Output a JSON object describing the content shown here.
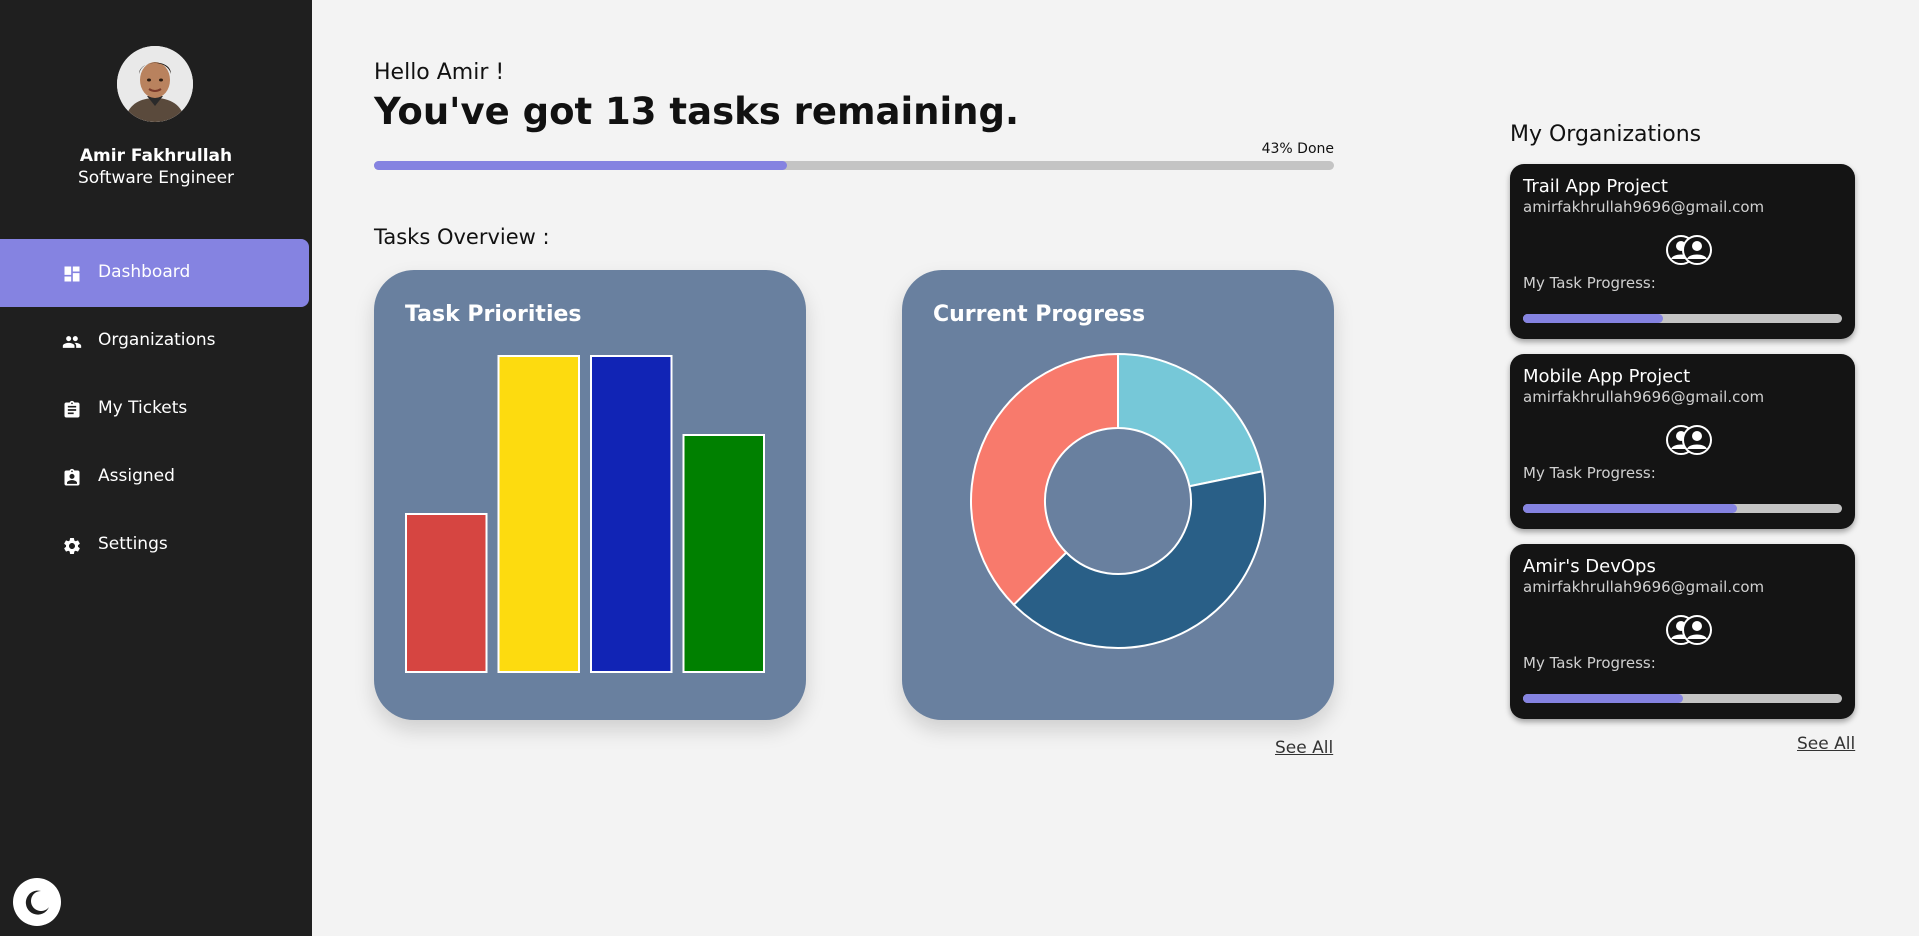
{
  "profile": {
    "name": "Amir Fakhrullah",
    "role": "Software Engineer"
  },
  "nav": [
    {
      "label": "Dashboard",
      "icon": "dashboard-icon",
      "active": true
    },
    {
      "label": "Organizations",
      "icon": "people-icon",
      "active": false
    },
    {
      "label": "My Tickets",
      "icon": "clipboard-icon",
      "active": false
    },
    {
      "label": "Assigned",
      "icon": "assigned-icon",
      "active": false
    },
    {
      "label": "Settings",
      "icon": "gear-icon",
      "active": false
    }
  ],
  "theme_toggle": {
    "icon": "moon-icon"
  },
  "header": {
    "greeting": "Hello Amir !",
    "headline": "You've got 13 tasks remaining.",
    "progress_label": "43% Done",
    "progress": 0.43
  },
  "overview": {
    "title": "Tasks Overview :",
    "see_all": "See All"
  },
  "priorities_card": {
    "title": "Task Priorities"
  },
  "progress_card": {
    "title": "Current Progress"
  },
  "chart_data": [
    {
      "type": "bar",
      "title": "Task Priorities",
      "categories": [
        "",
        "",
        "",
        ""
      ],
      "values": [
        2,
        4,
        4,
        3
      ],
      "colors": [
        "#d64541",
        "#fddb0f",
        "#1124b5",
        "#008000"
      ],
      "ylim": [
        0,
        4
      ]
    },
    {
      "type": "pie",
      "title": "Current Progress",
      "values": [
        2.83,
        5.3,
        4.87
      ],
      "colors": [
        "#76c8d8",
        "#295f87",
        "#f87a6c"
      ]
    }
  ],
  "organizations": {
    "title": "My Organizations",
    "see_all": "See All",
    "items": [
      {
        "name": "Trail App Project",
        "email": "amirfakhrullah9696@gmail.com",
        "progress_label": "My Task Progress:",
        "progress": 0.44
      },
      {
        "name": "Mobile App Project",
        "email": "amirfakhrullah9696@gmail.com",
        "progress_label": "My Task Progress:",
        "progress": 0.67
      },
      {
        "name": "Amir's DevOps",
        "email": "amirfakhrullah9696@gmail.com",
        "progress_label": "My Task Progress:",
        "progress": 0.5
      }
    ]
  },
  "colors": {
    "sidebar": "#1f1f1f",
    "accent": "#8583e1",
    "card": "#69809f",
    "org_card": "#141414",
    "background": "#f3f3f3"
  }
}
